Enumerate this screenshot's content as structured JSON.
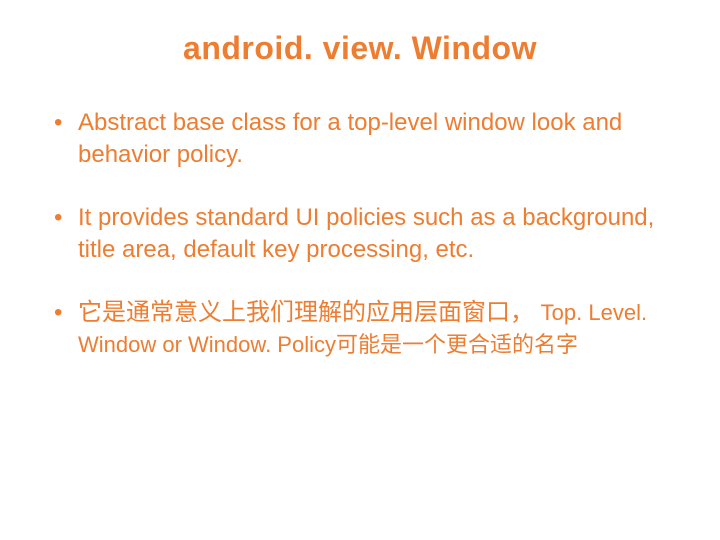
{
  "slide": {
    "title": "android. view. Window",
    "bullets": [
      {
        "text": "Abstract base class for a top-level window look and behavior policy."
      },
      {
        "text": "It provides standard UI policies such as a background, title area, default key processing, etc."
      },
      {
        "main": "它是通常意义上我们理解的应用层面窗口，",
        "sub": "Top. Level. Window or Window. Policy可能是一个更合适的名字"
      }
    ]
  }
}
